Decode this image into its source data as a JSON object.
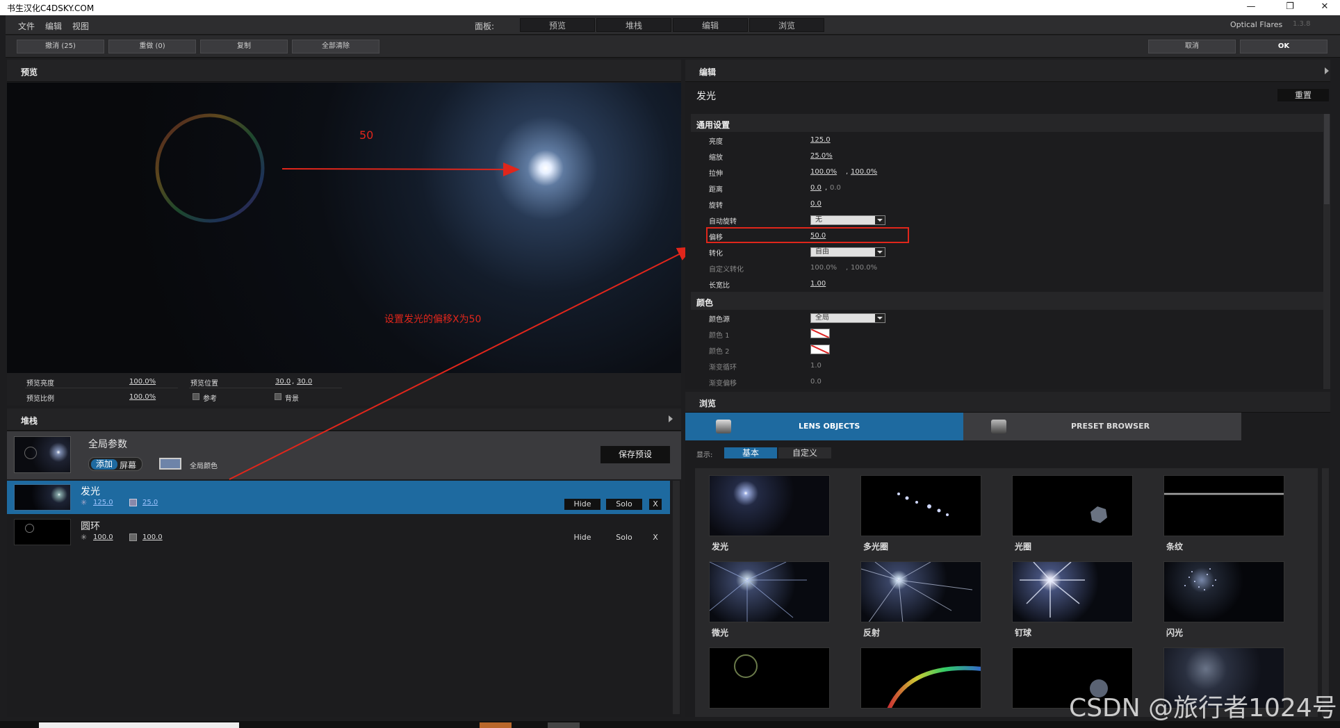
{
  "window": {
    "title": "书生汉化C4DSKY.COM",
    "min": "—",
    "restore": "❐",
    "close": "✕"
  },
  "menubar": {
    "items": [
      "文件",
      "编辑",
      "视图"
    ],
    "panel_label": "面板:",
    "panel_tabs": [
      "预览",
      "堆栈",
      "编辑",
      "浏览"
    ],
    "product": "Optical Flares",
    "version": "1.3.8"
  },
  "toolbar": {
    "undo": "撤消 (25)",
    "redo": "重做 (0)",
    "copy": "复制",
    "clear_all": "全部清除",
    "cancel": "取消",
    "ok": "OK"
  },
  "preview": {
    "title": "预览",
    "annotation_value": "50",
    "annotation_note": "设置发光的偏移X为50",
    "brightness_label": "预览亮度",
    "brightness_value": "100.0%",
    "scale_label": "预览比例",
    "scale_value": "100.0%",
    "position_label": "预览位置",
    "position_x": "30.0",
    "position_y": "30.0",
    "ref_label": "参考",
    "bg_label": "背景"
  },
  "stack": {
    "title": "堆栈",
    "global_title": "全局参数",
    "mode_add": "添加",
    "mode_screen": "屏幕",
    "global_color_label": "全局颜色",
    "save_preset": "保存预设",
    "items": [
      {
        "name": "发光",
        "brightness": "125.0",
        "scale": "25.0",
        "hide": "Hide",
        "solo": "Solo",
        "remove": "X"
      },
      {
        "name": "圆环",
        "brightness": "100.0",
        "scale": "100.0",
        "hide": "Hide",
        "solo": "Solo",
        "remove": "X"
      }
    ]
  },
  "editor": {
    "title": "编辑",
    "object_name": "发光",
    "reset": "重置",
    "general_section": "通用设置",
    "brightness_label": "亮度",
    "brightness": "125.0",
    "scale_label": "缩放",
    "scale": "25.0%",
    "stretch_label": "拉伸",
    "stretch_x": "100.0%",
    "stretch_y": "100.0%",
    "distance_label": "距离",
    "distance_x": "0.0",
    "distance_y": "0.0",
    "rotate_label": "旋转",
    "rotate": "0.0",
    "auto_rotate_label": "自动旋转",
    "auto_rotate": "无",
    "offset_label": "偏移",
    "offset": "50.0",
    "transform_label": "转化",
    "transform": "自由",
    "custom_transform_label": "自定义转化",
    "custom_transform_x": "100.0%",
    "custom_transform_y": "100.0%",
    "aspect_label": "长宽比",
    "aspect": "1.00",
    "color_section": "颜色",
    "color_source_label": "颜色源",
    "color_source": "全局",
    "color1_label": "颜色 1",
    "color2_label": "颜色 2",
    "gradient_loop_label": "渐变循环",
    "gradient_loop": "1.0",
    "gradient_offset_label": "渐变偏移",
    "gradient_offset": "0.0"
  },
  "browser": {
    "title": "浏览",
    "tab_lens": "LENS OBJECTS",
    "tab_preset": "PRESET BROWSER",
    "show_label": "显示:",
    "show_basic": "基本",
    "show_custom": "自定义",
    "items": [
      "发光",
      "多光圈",
      "光圈",
      "条纹",
      "微光",
      "反射",
      "钉球",
      "闪光"
    ]
  },
  "watermark": "CSDN @旅行者1024号",
  "colors": {
    "accent_blue": "#1e6aa0",
    "link_blue": "#5d9be6",
    "annotation_red": "#e0261b"
  }
}
